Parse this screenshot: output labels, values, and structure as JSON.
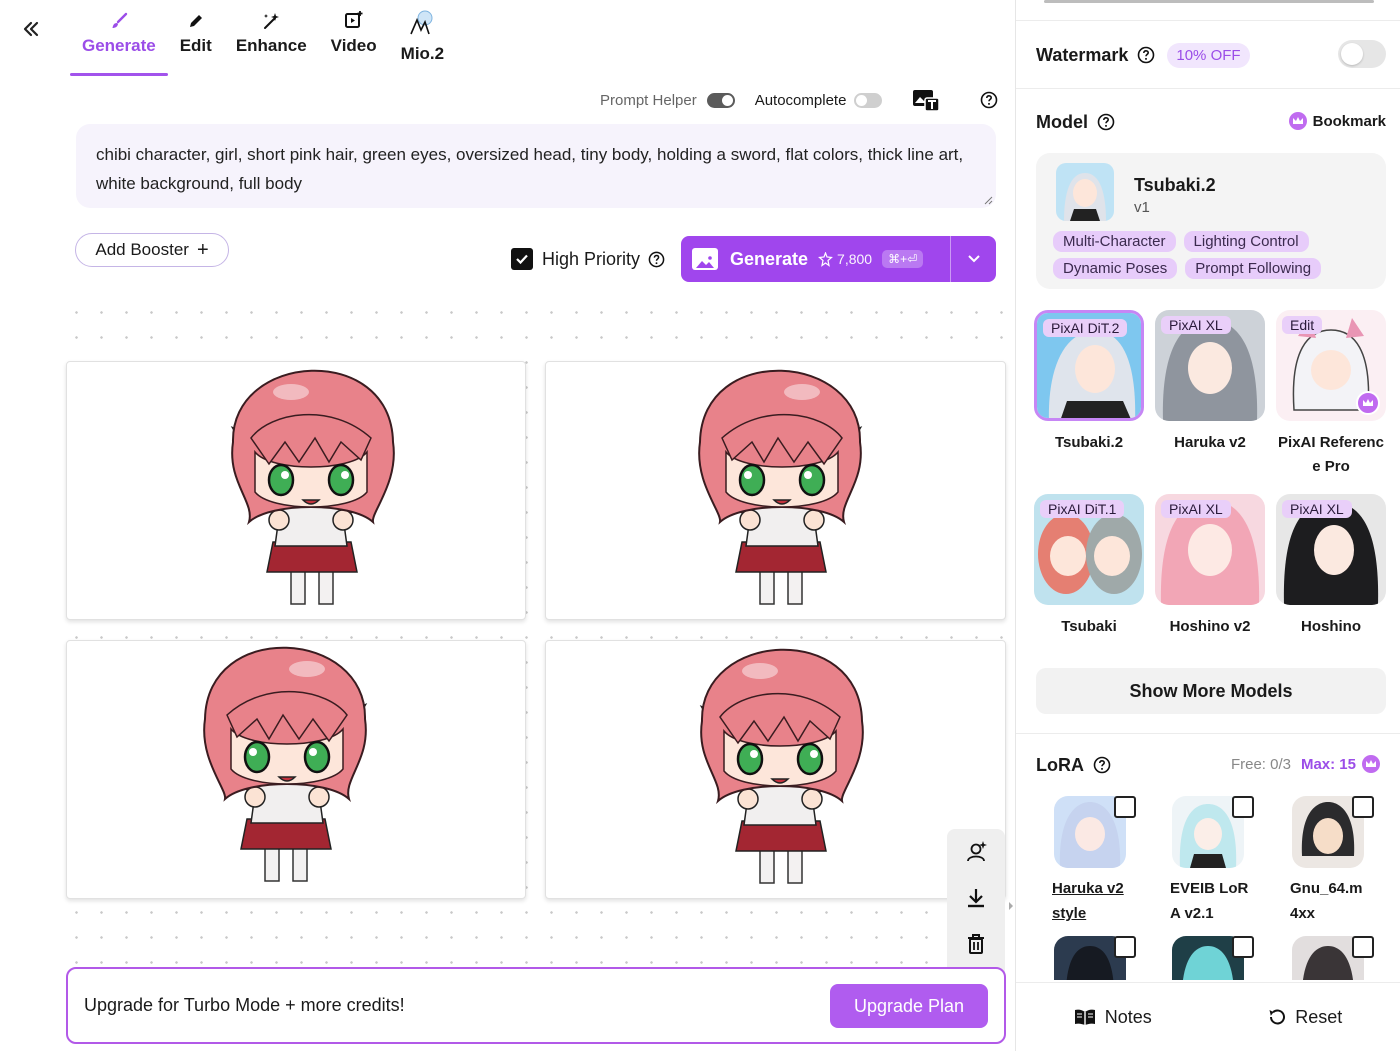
{
  "tabs": [
    {
      "label": "Generate",
      "icon": "brush-icon",
      "active": true
    },
    {
      "label": "Edit",
      "icon": "pencil-icon"
    },
    {
      "label": "Enhance",
      "icon": "magic-wand-icon"
    },
    {
      "label": "Video",
      "icon": "video-plus-icon"
    },
    {
      "label": "Mio.2",
      "icon": "mio-logo-icon"
    }
  ],
  "toolbar": {
    "prompt_helper_label": "Prompt Helper",
    "prompt_helper_on": true,
    "autocomplete_label": "Autocomplete",
    "autocomplete_on": false
  },
  "prompt": {
    "text": "chibi character, girl, short pink hair, green eyes, oversized head, tiny body, holding a sword, flat colors, thick line art, white background, full body"
  },
  "booster": {
    "label": "Add Booster",
    "plus": "+"
  },
  "priority": {
    "label": "High Priority",
    "checked": true
  },
  "generate": {
    "label": "Generate",
    "cost": "7,800",
    "shortcut": "⌘+⏎"
  },
  "upgrade": {
    "message": "Upgrade for Turbo Mode + more credits!",
    "button": "Upgrade Plan"
  },
  "watermark": {
    "title": "Watermark",
    "badge": "10% OFF",
    "enabled": false
  },
  "model": {
    "title": "Model",
    "bookmark_label": "Bookmark",
    "current": {
      "name": "Tsubaki.2",
      "version": "v1",
      "tags": [
        "Multi-Character",
        "Lighting Control",
        "Dynamic Poses",
        "Prompt Following"
      ]
    },
    "options": [
      {
        "name": "Tsubaki.2",
        "tag": "PixAI DiT.2",
        "selected": true
      },
      {
        "name": "Haruka v2",
        "tag": "PixAI XL"
      },
      {
        "name_line1": "PixAI Referenc",
        "name_line2": "e Pro",
        "tag": "Edit",
        "premium": true
      },
      {
        "name": "Tsubaki",
        "tag": "PixAI DiT.1"
      },
      {
        "name": "Hoshino v2",
        "tag": "PixAI XL"
      },
      {
        "name": "Hoshino",
        "tag": "PixAI XL"
      }
    ],
    "show_more": "Show More Models"
  },
  "lora": {
    "title": "LoRA",
    "free": "Free: 0/3",
    "max": "Max: 15",
    "items": [
      {
        "line1": "Haruka v2",
        "line2": "style"
      },
      {
        "line1": "EVEIB LoR",
        "line2": "A v2.1"
      },
      {
        "line1": "Gnu_64.m",
        "line2": "4xx"
      }
    ]
  },
  "footer": {
    "notes": "Notes",
    "reset": "Reset"
  },
  "colors": {
    "accent": "#a046ed",
    "chip": "#e7ccfa",
    "hair": "#e8828a",
    "eyes": "#3fae55"
  }
}
